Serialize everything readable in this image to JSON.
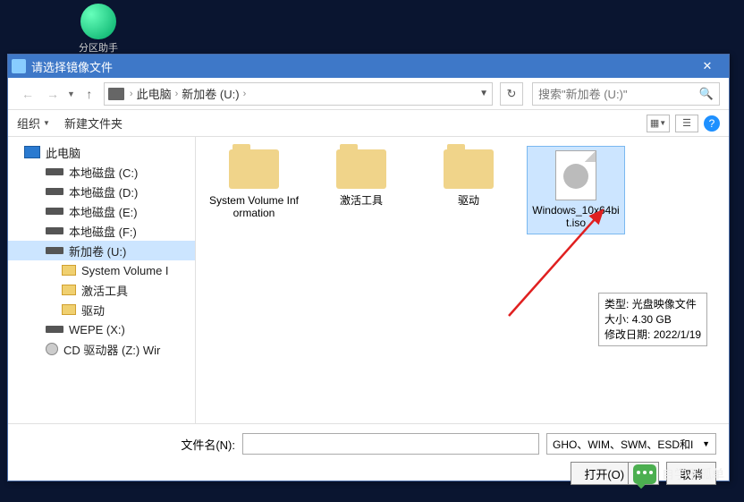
{
  "desktop": {
    "icon_label": "分区助手"
  },
  "titlebar": {
    "title": "请选择镜像文件"
  },
  "breadcrumb": {
    "pc": "此电脑",
    "drive": "新加卷 (U:)"
  },
  "search": {
    "placeholder": "搜索\"新加卷 (U:)\""
  },
  "toolbar": {
    "organize": "组织",
    "new_folder": "新建文件夹"
  },
  "tree": {
    "pc": "此电脑",
    "drive_c": "本地磁盘 (C:)",
    "drive_d": "本地磁盘 (D:)",
    "drive_e": "本地磁盘 (E:)",
    "drive_f": "本地磁盘 (F:)",
    "drive_u": "新加卷 (U:)",
    "svi": "System Volume I",
    "activate": "激活工具",
    "driver": "驱动",
    "wepe": "WEPE (X:)",
    "cd": "CD 驱动器 (Z:) Wir"
  },
  "items": {
    "svi": "System Volume Information",
    "activate": "激活工具",
    "driver": "驱动",
    "iso": "Windows_10x64bit.iso"
  },
  "tooltip": {
    "type_label": "类型:",
    "type_value": "光盘映像文件",
    "size_label": "大小:",
    "size_value": "4.30 GB",
    "date_label": "修改日期:",
    "date_value": "2022/1/19"
  },
  "footer": {
    "filename_label": "文件名(N):",
    "filter": "GHO、WIM、SWM、ESD和I",
    "open": "打开(O)",
    "cancel": "取消"
  },
  "watermark": {
    "text": "自学不孤单"
  }
}
